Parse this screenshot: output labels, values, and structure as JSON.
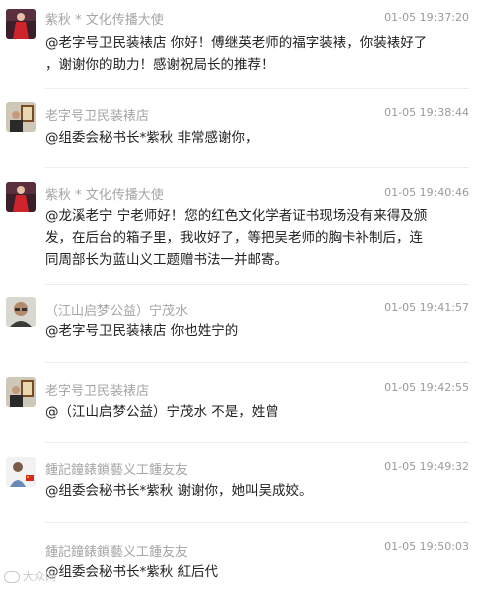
{
  "messages": [
    {
      "avatar": "avatar-woman-red-dress",
      "name": "紫秋 * 文化传播大使",
      "time": "01-05 19:37:20",
      "lines": [
        "@老字号卫民装裱店 你好！傅继英老师的福字装裱，你装裱好了",
        "，谢谢你的助力！感谢祝局长的推荐！"
      ]
    },
    {
      "avatar": "avatar-man-with-frame",
      "name": "老字号卫民装裱店",
      "time": "01-05 19:38:44",
      "lines": [
        "@组委会秘书长*紫秋 非常感谢你，"
      ]
    },
    {
      "avatar": "avatar-woman-red-dress",
      "name": "紫秋 * 文化传播大使",
      "time": "01-05 19:40:46",
      "lines": [
        "@龙溪老宁 宁老师好！您的红色文化学者证书现场没有来得及颁",
        "发，在后台的箱子里，我收好了，等把吴老师的胸卡补制后，连",
        "同周部长为蓝山义工题赠书法一并邮寄。"
      ]
    },
    {
      "avatar": "avatar-man-glasses",
      "name": "（江山启梦公益）宁茂水",
      "time": "01-05 19:41:57",
      "lines": [
        "@老字号卫民装裱店 你也姓宁的"
      ]
    },
    {
      "avatar": "avatar-man-with-frame",
      "name": "老字号卫民装裱店",
      "time": "01-05 19:42:55",
      "lines": [
        "@（江山启梦公益）宁茂水 不是，姓曾"
      ]
    },
    {
      "avatar": "avatar-child-flag",
      "name": "鍾記鐘錶鎖藝义工鍾友友",
      "time": "01-05 19:49:32",
      "lines": [
        "@组委会秘书长*紫秋 谢谢你，她叫吴成姣。"
      ]
    },
    {
      "avatar": "",
      "name": "鍾記鐘錶鎖藝义工鍾友友",
      "time": "01-05 19:50:03",
      "lines": [
        "@组委会秘书长*紫秋 紅后代"
      ]
    }
  ],
  "watermark": "大众网",
  "colors": {
    "name": "#a5a5a5",
    "text": "#222222",
    "time": "#9a9a9a",
    "divider": "#ececec"
  }
}
